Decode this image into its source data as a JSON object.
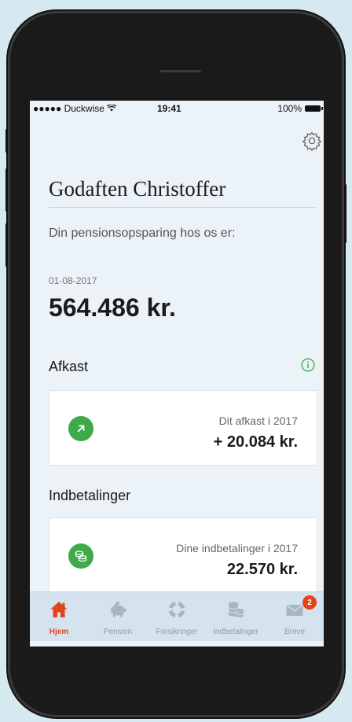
{
  "status_bar": {
    "carrier": "●●●●● Duckwise",
    "time": "19:41",
    "battery": "100%"
  },
  "header": {
    "greeting": "Godaften Christoffer",
    "subtitle": "Din pensionsopsparing hos os er:"
  },
  "balance": {
    "date": "01-08-2017",
    "amount": "564.486 kr."
  },
  "afkast": {
    "title": "Afkast",
    "card_label": "Dit afkast i 2017",
    "card_value": "+ 20.084 kr."
  },
  "indbetalinger": {
    "title": "Indbetalinger",
    "card_label": "Dine indbetalinger i 2017",
    "card_value": "22.570 kr."
  },
  "tabbar": {
    "items": [
      {
        "label": "Hjem",
        "icon": "home-icon",
        "active": true
      },
      {
        "label": "Pension",
        "icon": "piggy-bank-icon",
        "active": false
      },
      {
        "label": "Forsikringer",
        "icon": "lifebuoy-icon",
        "active": false
      },
      {
        "label": "Indbetalinger",
        "icon": "coins-icon",
        "active": false
      },
      {
        "label": "Breve",
        "icon": "envelope-icon",
        "active": false,
        "badge": "2"
      }
    ]
  },
  "colors": {
    "accent": "#e2431c",
    "positive": "#3eaa4a",
    "background": "#ebf2f8",
    "tabbar": "#d5e3ee"
  }
}
